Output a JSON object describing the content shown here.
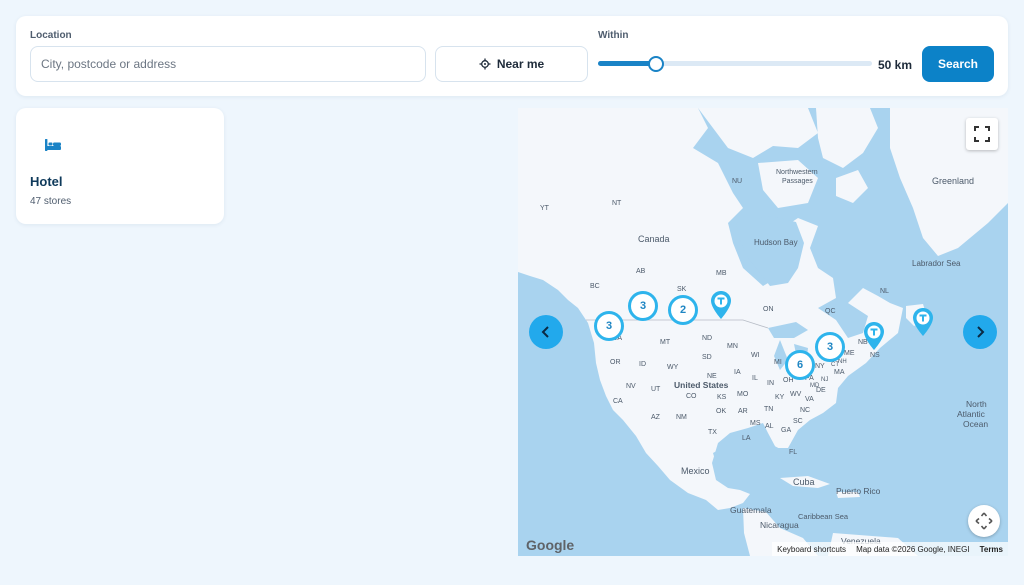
{
  "search": {
    "location_label": "Location",
    "location_placeholder": "City, postcode or address",
    "near_me_label": "Near me",
    "within_label": "Within",
    "radius_value": "50 km",
    "radius_fraction": 0.21,
    "search_label": "Search"
  },
  "categories": [
    {
      "name": "Hotel",
      "count": "47 stores",
      "icon": "hotel-bed-icon"
    }
  ],
  "map": {
    "labels": {
      "nunavut": "NU",
      "yukon": "YT",
      "nwt": "NT",
      "canada": "Canada",
      "hudson_bay": "Hudson Bay",
      "nw_passages_1": "Northwestern",
      "nw_passages_2": "Passages",
      "greenland": "Greenland",
      "labrador_sea": "Labrador Sea",
      "bc": "BC",
      "ab": "AB",
      "sk": "SK",
      "mb": "MB",
      "on": "ON",
      "qc": "QC",
      "nl": "NL",
      "wa": "WA",
      "mt": "MT",
      "nd": "ND",
      "mn": "MN",
      "or": "OR",
      "id": "ID",
      "wy": "WY",
      "sd": "SD",
      "wi": "WI",
      "mi": "MI",
      "ny": "NY",
      "me": "ME",
      "nv": "NV",
      "ut": "UT",
      "ne": "NE",
      "ia": "IA",
      "il": "IL",
      "in": "IN",
      "oh": "OH",
      "pa": "PA",
      "united_states": "United States",
      "ca": "CA",
      "co": "CO",
      "ks": "KS",
      "mo": "MO",
      "ky": "KY",
      "wv": "WV",
      "va": "VA",
      "de": "DE",
      "md": "MD",
      "nj": "NJ",
      "ct": "CT",
      "ma": "MA",
      "nh": "NH",
      "vt": "VT",
      "ns": "NS",
      "nb": "NB",
      "az": "AZ",
      "nm": "NM",
      "ok": "OK",
      "ar": "AR",
      "tn": "TN",
      "nc": "NC",
      "sc": "SC",
      "ms": "MS",
      "al": "AL",
      "ga": "GA",
      "tx": "TX",
      "la": "LA",
      "fl": "FL",
      "mexico": "Mexico",
      "cuba": "Cuba",
      "puerto_rico": "Puerto Rico",
      "guatemala": "Guatemala",
      "caribbean_sea": "Caribbean Sea",
      "nicaragua": "Nicaragua",
      "venezuela": "Venezuela",
      "ocean_1": "North",
      "ocean_2": "Atlantic",
      "ocean_3": "Ocean"
    },
    "clusters": [
      {
        "count": "3"
      },
      {
        "count": "3"
      },
      {
        "count": "2"
      },
      {
        "count": "6"
      },
      {
        "count": "3"
      }
    ],
    "google": "Google",
    "attribution": {
      "shortcuts": "Keyboard shortcuts",
      "data": "Map data ©2026 Google, INEGI",
      "terms": "Terms"
    }
  },
  "colors": {
    "accent": "#0c82c8",
    "cluster": "#2eb4ec",
    "arrow": "#22a9ec",
    "land": "#f4f7fb",
    "water": "#a9d3ef"
  }
}
